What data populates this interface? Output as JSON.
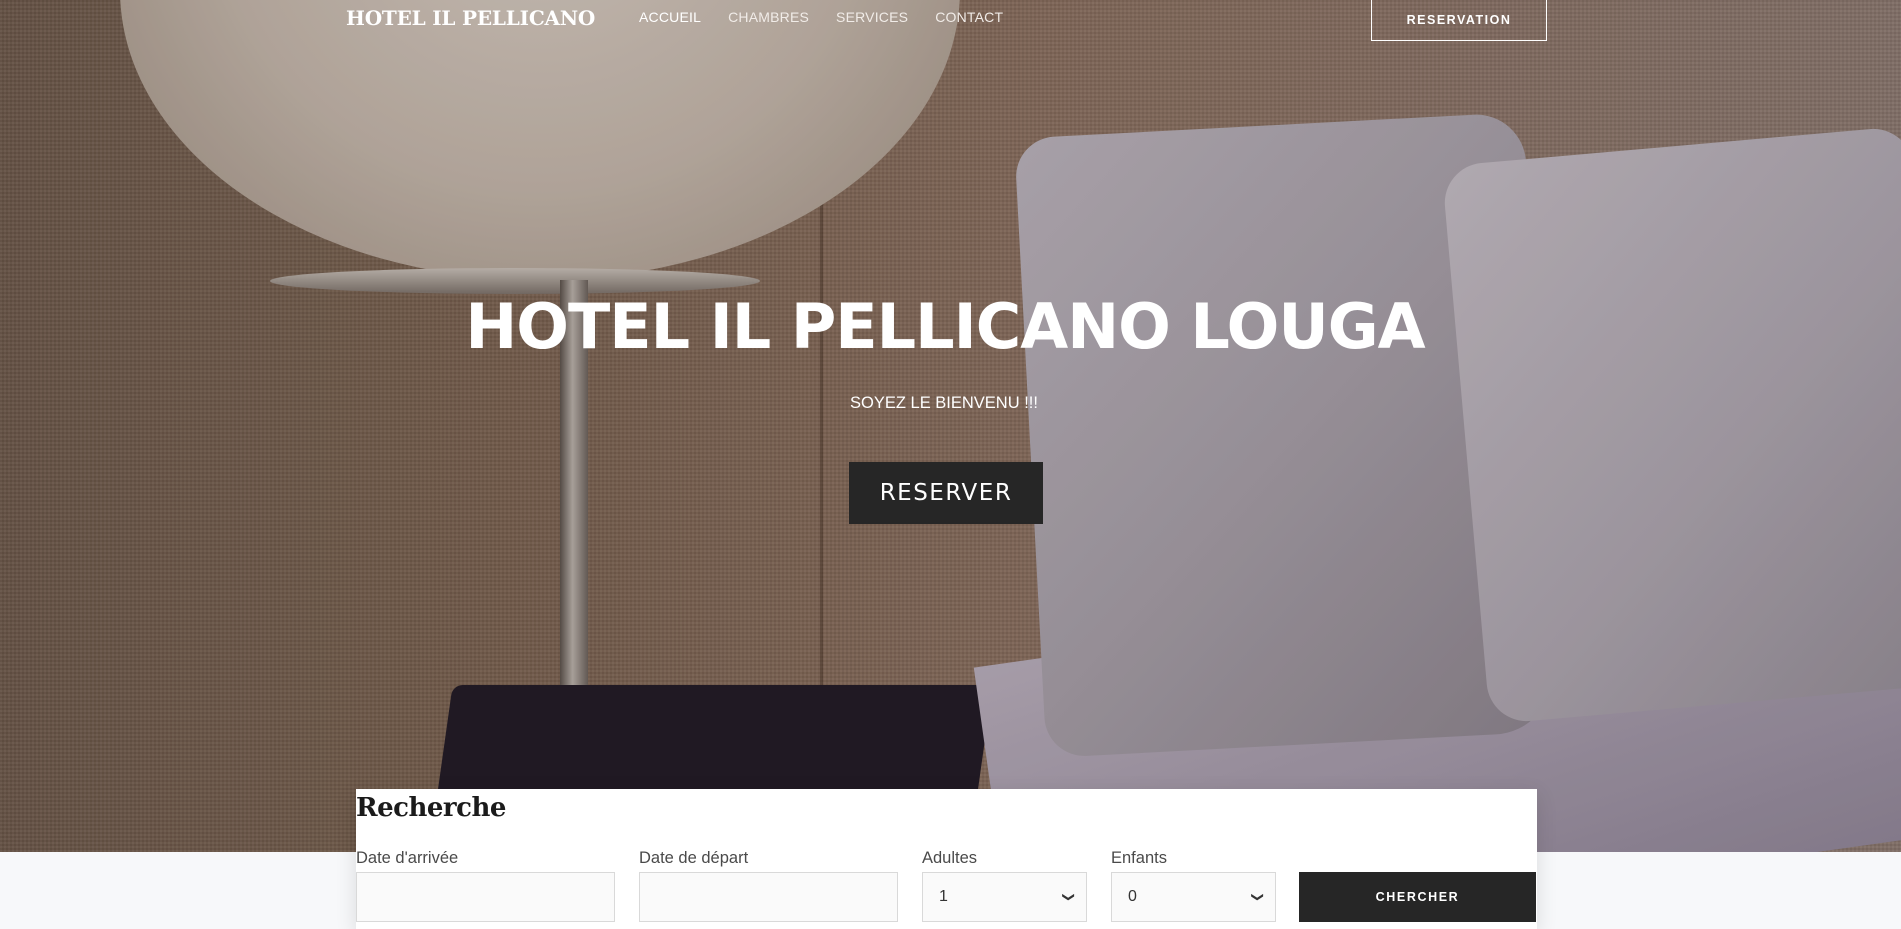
{
  "brand": {
    "logo": "HOTEL IL PELLICANO"
  },
  "nav": {
    "items": [
      "ACCUEIL",
      "CHAMBRES",
      "SERVICES",
      "CONTACT"
    ],
    "active_index": 0,
    "reserve_button": "RESERVATION"
  },
  "hero": {
    "title": "HOTEL IL PELLICANO LOUGA",
    "subtitle": "SOYEZ LE BIENVENU !!!",
    "button": "RESERVER"
  },
  "search": {
    "title": "Recherche",
    "arrival_label": "Date d'arrivée",
    "arrival_value": "",
    "departure_label": "Date de départ",
    "departure_value": "",
    "adults_label": "Adultes",
    "adults_value": "1",
    "children_label": "Enfants",
    "children_value": "0",
    "search_button": "CHERCHER"
  },
  "colors": {
    "button_dark": "#262626",
    "page_bg": "#f7f8fa",
    "text_white": "#ffffff"
  },
  "icons": {
    "select_arrow": "chevron-down-icon"
  }
}
